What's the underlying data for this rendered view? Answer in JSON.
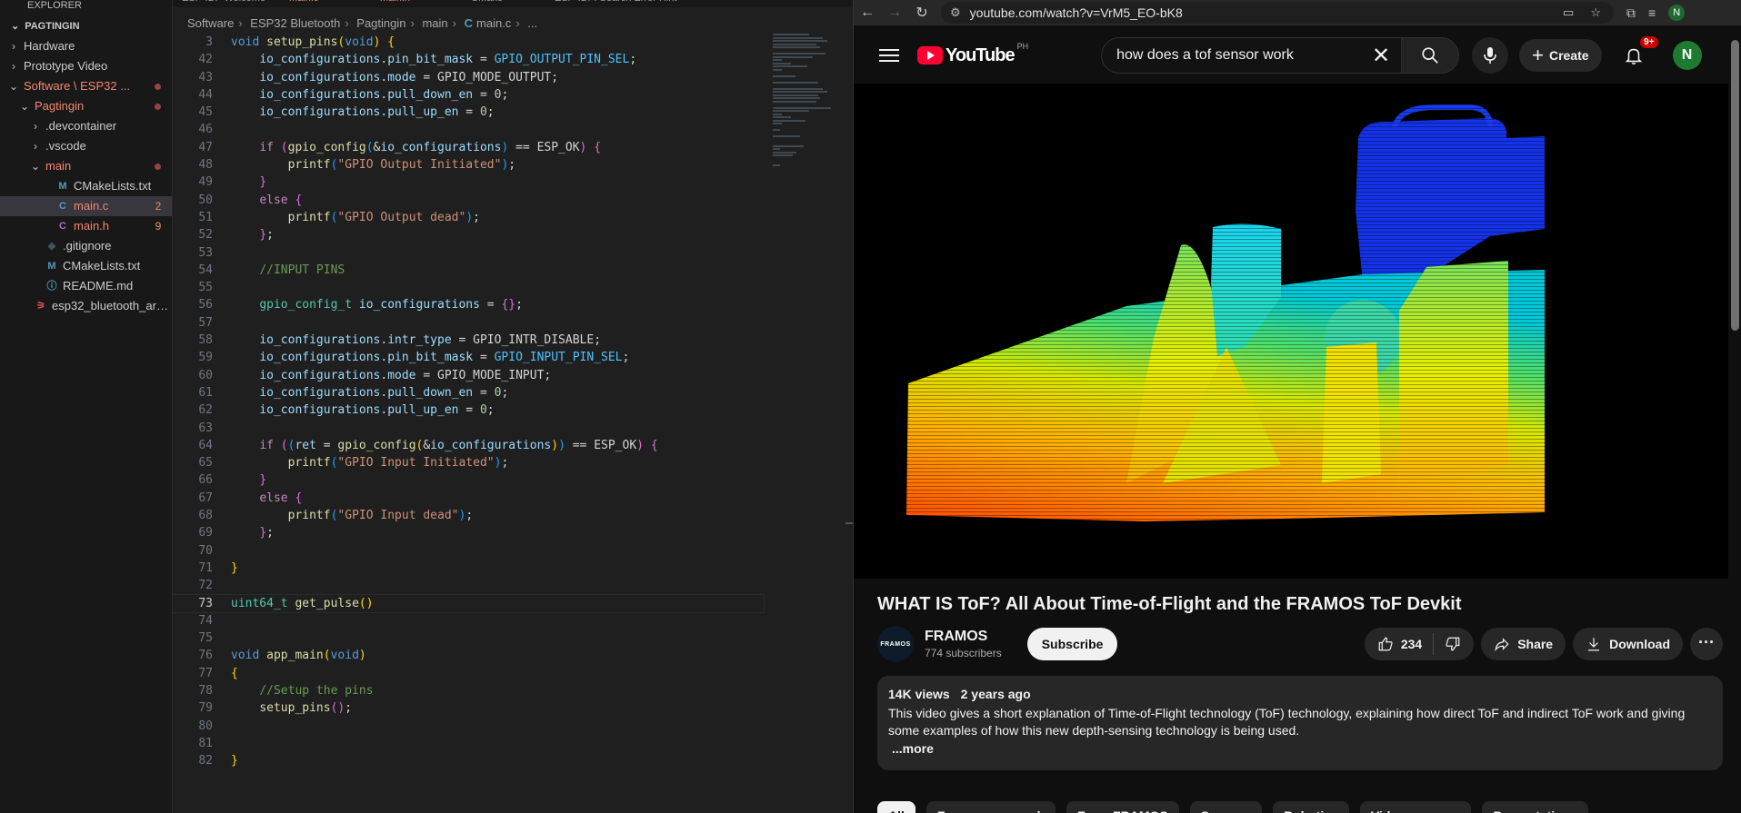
{
  "vscode": {
    "explorer_title": "EXPLORER",
    "root": "PAGTINGIN",
    "tree": [
      {
        "label": "Hardware",
        "depth": 1,
        "chev": "›",
        "icon": "",
        "kind": "folder"
      },
      {
        "label": "Prototype Video",
        "depth": 1,
        "chev": "›",
        "icon": "",
        "kind": "folder"
      },
      {
        "label": "Software \\ ESP32 ...",
        "depth": 1,
        "chev": "⌄",
        "icon": "",
        "kind": "folder-mod"
      },
      {
        "label": "Pagtingin",
        "depth": 2,
        "chev": "⌄",
        "icon": "",
        "kind": "folder-mod"
      },
      {
        "label": ".devcontainer",
        "depth": 3,
        "chev": "›",
        "icon": "",
        "kind": "folder"
      },
      {
        "label": ".vscode",
        "depth": 3,
        "chev": "›",
        "icon": "",
        "kind": "folder"
      },
      {
        "label": "main",
        "depth": 3,
        "chev": "⌄",
        "icon": "",
        "kind": "folder-mod"
      },
      {
        "label": "CMakeLists.txt",
        "depth": 4,
        "chev": "",
        "icon": "M",
        "kind": "file"
      },
      {
        "label": "main.c",
        "depth": 4,
        "chev": "",
        "icon": "C",
        "kind": "file-err",
        "badge": "2",
        "selected": true
      },
      {
        "label": "main.h",
        "depth": 4,
        "chev": "",
        "icon": "C",
        "kind": "file-err-h",
        "badge": "9"
      },
      {
        "label": ".gitignore",
        "depth": 3,
        "chev": "",
        "icon": "◆",
        "kind": "file"
      },
      {
        "label": "CMakeLists.txt",
        "depth": 3,
        "chev": "",
        "icon": "M",
        "kind": "file"
      },
      {
        "label": "README.md",
        "depth": 3,
        "chev": "",
        "icon": "ⓘ",
        "kind": "file"
      },
      {
        "label": "esp32_bluetooth_arc...",
        "depth": 2,
        "chev": "",
        "icon": "⚞",
        "kind": "file"
      }
    ],
    "tabs": [
      "ESP-IDF Welcome",
      "main.c",
      "main.h",
      "CMake",
      "ESP-IDF: Search Error Hint"
    ],
    "breadcrumb": [
      "Software",
      "ESP32 Bluetooth",
      "Pagtingin",
      "main",
      "main.c",
      "..."
    ],
    "current_line": "73"
  },
  "browser": {
    "url": "youtube.com/watch?v=VrM5_EO-bK8",
    "search_query": "how does a tof sensor work",
    "logo_text": "YouTube",
    "country_code": "PH",
    "create_label": "Create",
    "notif_count": "9+",
    "avatar_letter": "N",
    "video_title": "WHAT IS ToF? All About Time-of-Flight and the FRAMOS ToF Devkit",
    "channel_name": "FRAMOS",
    "channel_avatar_text": "FRAMOS",
    "subscribers": "774 subscribers",
    "subscribe_label": "Subscribe",
    "likes": "234",
    "share_label": "Share",
    "download_label": "Download",
    "views": "14K views",
    "age": "2 years ago",
    "description": "This video gives a short explanation of Time-of-Flight technology (ToF) technology, explaining how direct ToF and indirect ToF work and giving some examples of how this new depth-sensing technology is being used.",
    "more_label": "...more",
    "chips": [
      "All",
      "From your search",
      "From FRAMOS",
      "Sensors",
      "Robotics",
      "Video cameras",
      "Presentations"
    ]
  },
  "colors": {
    "yt_red": "#ff0033",
    "vscode_bg": "#1f1f1f",
    "yt_bg": "#0f0f0f"
  }
}
